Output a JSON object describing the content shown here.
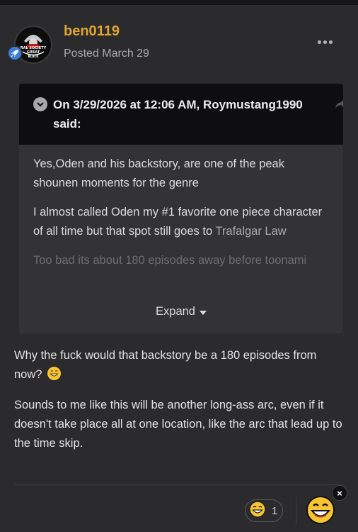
{
  "author": {
    "username": "ben0119",
    "posted": "Posted March 29",
    "avatar_text": [
      "RAL SOCIETY",
      "GREAT",
      "BLACK"
    ],
    "rank_icon": "rocket-icon"
  },
  "menu": {
    "icon": "ellipsis-icon"
  },
  "quote": {
    "title": "On 3/29/2026 at 12:06 AM, Roymustang1990 said:",
    "paragraphs": [
      "Yes,Oden and his backstory, are one of the peak shounen moments for the genre",
      "I almost called Oden my #1 favorite one piece character of all time but that spot still goes to"
    ],
    "link_text": "Trafalgar Law",
    "faded_text": "Too bad its about 180 episodes away before toonami",
    "expand_label": "Expand"
  },
  "post": {
    "p1": "Why the fuck would that backstory be a 180 episodes from now?",
    "p2": "Sounds to me like this will be another long-ass arc, even if it doesn't take place all at one location, like the arc that lead up to the time skip."
  },
  "reactions": {
    "count": "1",
    "icon": "grin-emoji-icon",
    "close": "×"
  },
  "colors": {
    "background": "#2b2b2e",
    "username": "#e0a530",
    "quote_header": "#0e0e10",
    "quote_body": "#333336",
    "rank_badge": "#3b7dd8"
  }
}
